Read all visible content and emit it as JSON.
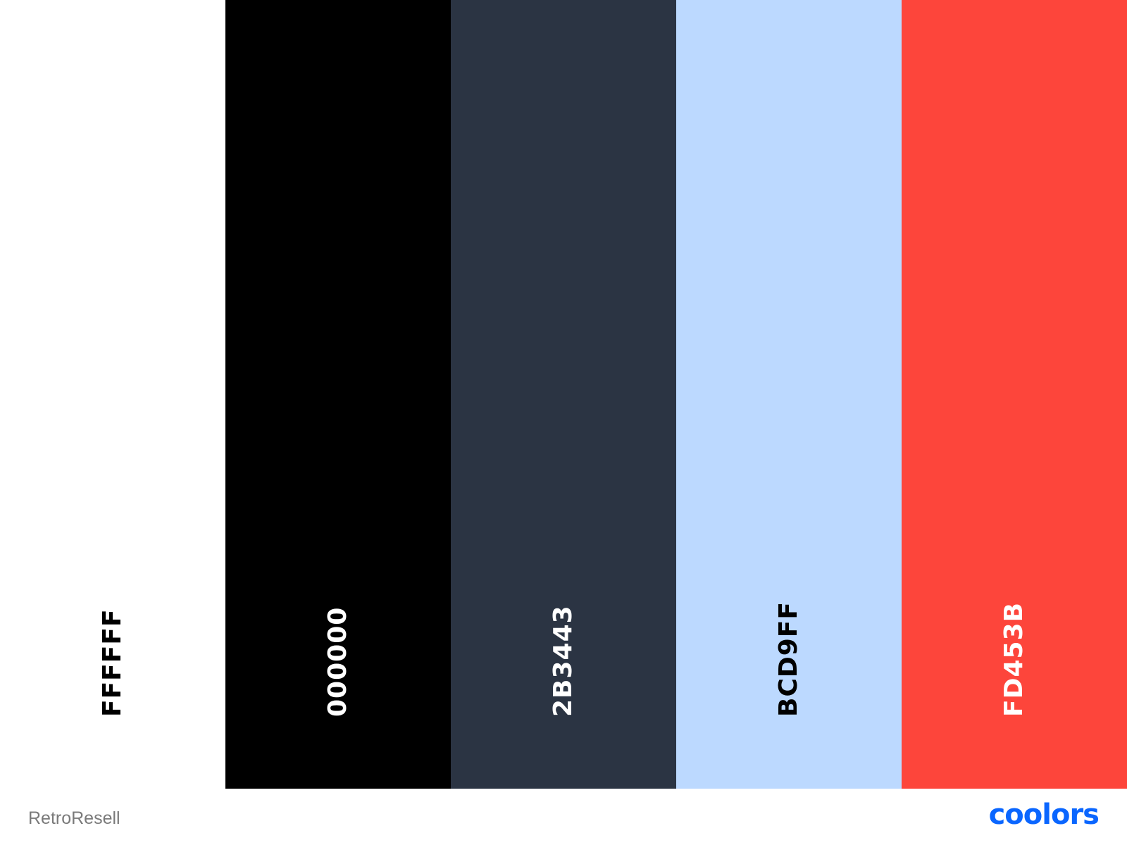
{
  "palette": {
    "name": "RetroResell",
    "swatches": [
      {
        "hex": "FFFFFF",
        "color": "#FFFFFF",
        "text_color": "#000000"
      },
      {
        "hex": "000000",
        "color": "#000000",
        "text_color": "#FFFFFF"
      },
      {
        "hex": "2B3443",
        "color": "#2B3443",
        "text_color": "#FFFFFF"
      },
      {
        "hex": "BCD9FF",
        "color": "#BCD9FF",
        "text_color": "#000000"
      },
      {
        "hex": "FD453B",
        "color": "#FD453B",
        "text_color": "#FFFFFF"
      }
    ]
  },
  "brand": {
    "logo_text": "coolors",
    "color": "#0A66FF"
  }
}
